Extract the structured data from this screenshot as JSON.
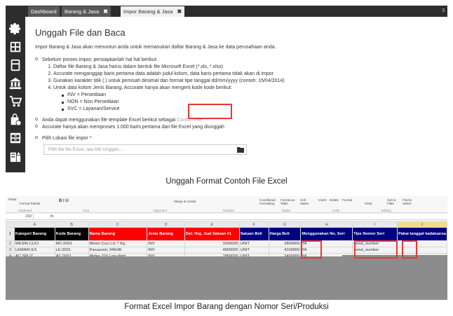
{
  "tabs": [
    {
      "label": "Dashboard"
    },
    {
      "label": "Barang & Jasa",
      "close": "✖"
    },
    {
      "label": "Impor Barang & Jasa",
      "close": "✖"
    }
  ],
  "tab_right": "3",
  "sidebar_icons": [
    "settings-icon",
    "grid-icon",
    "calculator-icon",
    "bank-icon",
    "cart-icon",
    "shopping-bag-icon",
    "archive-icon",
    "building-icon"
  ],
  "content": {
    "title": "Unggah File dan Baca",
    "intro": "Impor Barang & Jasa akan menuntun anda untuk memasukan daftar Barang & Jasa ke data perusahaan anda.",
    "prep_title": "Sebelum proses impor, persiapkanlah hal hal berikut:",
    "steps": [
      "Daftar file Barang & Jasa harus dalam bentuk file Microsoft Excel (*.xls, *.xlsx)",
      "Accurate menganggap baris pertama data adalah judul kolom, data baris pertama tidak akan di impor",
      "Gunakan karakter titik (.) untuk pemisah desimal dan format tipe tanggal dd/mm/yyyy (contoh: 15/04/2014)",
      "Untuk data kolom Jenis Barang, Accurate hanya akan mengerti kode kode berikut:"
    ],
    "codes": [
      "INV = Persediaan",
      "NON = Non Persediaan",
      "SVC = Layanan/Service"
    ],
    "template_text": "Anda dapat menggunakan file template Excel berikut sebagai ",
    "template_link": "Contoh File",
    "limit_text": "Accurate hanya akan memproses 1.000 baris pertama dari file Excel yang diunggah",
    "file_label": "Pilih Lokasi file impor",
    "required_mark": "*",
    "file_placeholder": "Pilih file Ms Excel, lalu klik Unggah..."
  },
  "caption1": "Unggah Format Contoh File Excel",
  "caption2": "Format Excel Impor Barang dengan Nomor Seri/Produksi",
  "excel": {
    "name_box": "J10",
    "fx": "fx",
    "ribbon": {
      "paste": "Paste",
      "format_painter": "Format Painter",
      "clipboard": "Clipboard",
      "font": "Font",
      "alignment": "Alignment",
      "merge": "Merge & Center",
      "number": "Number",
      "cond_format": "Conditional Formatting",
      "format_table": "Format as Table",
      "cell_styles": "Cell Styles",
      "styles": "Styles",
      "insert": "Insert",
      "delete": "Delete",
      "format": "Format",
      "cells": "Cells",
      "clear": "Clear",
      "sort": "Sort & Filter",
      "find": "Find & Select",
      "editing": "Editing"
    },
    "columns": [
      "A",
      "B",
      "C",
      "D",
      "E",
      "F",
      "G",
      "H",
      "I",
      "J"
    ],
    "headers": [
      "Kategori Barang",
      "Kode Barang",
      "Nama Barang",
      "Jenis Barang",
      "Def. Hrg. Jual Satuan #1",
      "Satuan Beli",
      "Harga Beli",
      "Menggunakan No. Seri",
      "Tipe Nomor Seri",
      "Pakai tanggal kadaluarsa"
    ],
    "header_colors": [
      "#000000",
      "#000000",
      "#ff0000",
      "#ff0000",
      "#ff0000",
      "#000080",
      "#000080",
      "#000080",
      "#000080",
      "#000080"
    ],
    "rows": [
      [
        "MESIN CUCI",
        "MC.0001",
        "Mesin Cuci LG 7 Kg",
        "INV",
        "3200000",
        "UNIT",
        "2890000",
        "YA",
        "serial_number",
        ""
      ],
      [
        "LEMARI ES",
        "LE.0001",
        "Panasonic 346HB",
        "INV",
        "4560000",
        "UNIT",
        "4100000",
        "YA",
        "serial_number",
        ""
      ],
      [
        "AC SPLIT",
        "AC.0001",
        "Midea 316 Low Watt",
        "INV",
        "2850000",
        "UNIT",
        "2400000",
        "YA",
        "",
        ""
      ]
    ]
  }
}
